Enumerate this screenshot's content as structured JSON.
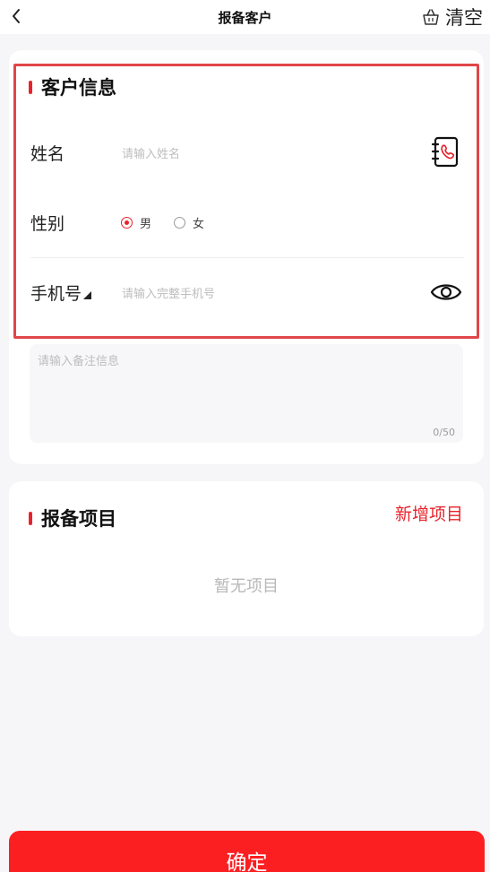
{
  "header": {
    "title": "报备客户",
    "clear_label": "清空"
  },
  "customer_section": {
    "title": "客户信息",
    "name_label": "姓名",
    "name_placeholder": "请输入姓名",
    "gender_label": "性别",
    "gender_options": [
      "男",
      "女"
    ],
    "gender_selected": "男",
    "phone_label": "手机号",
    "phone_placeholder": "请输入完整手机号",
    "remark_placeholder": "请输入备注信息",
    "remark_count": "0/50"
  },
  "project_section": {
    "title": "报备项目",
    "add_label": "新增项目",
    "empty_text": "暂无项目"
  },
  "footer": {
    "confirm_label": "确定"
  },
  "colors": {
    "accent": "#e8232b",
    "button": "#fc1f22",
    "highlight": "#e0464a"
  }
}
